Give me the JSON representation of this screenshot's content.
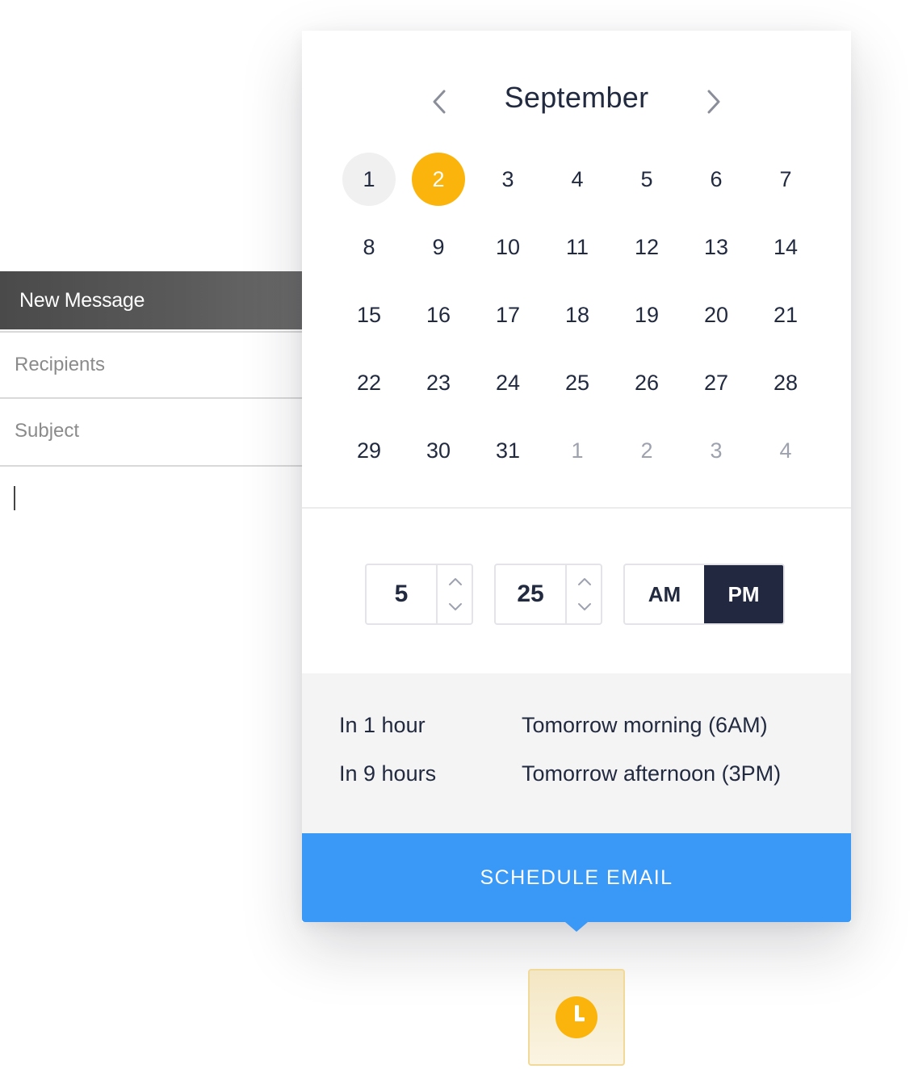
{
  "compose": {
    "title": "New Message",
    "recipients_placeholder": "Recipients",
    "subject_placeholder": "Subject"
  },
  "calendar": {
    "month": "September",
    "weeks": [
      [
        {
          "d": "1",
          "state": "today"
        },
        {
          "d": "2",
          "state": "selected"
        },
        {
          "d": "3"
        },
        {
          "d": "4"
        },
        {
          "d": "5"
        },
        {
          "d": "6"
        },
        {
          "d": "7"
        }
      ],
      [
        {
          "d": "8"
        },
        {
          "d": "9"
        },
        {
          "d": "10"
        },
        {
          "d": "11"
        },
        {
          "d": "12"
        },
        {
          "d": "13"
        },
        {
          "d": "14"
        }
      ],
      [
        {
          "d": "15"
        },
        {
          "d": "16"
        },
        {
          "d": "17"
        },
        {
          "d": "18"
        },
        {
          "d": "19"
        },
        {
          "d": "20"
        },
        {
          "d": "21"
        }
      ],
      [
        {
          "d": "22"
        },
        {
          "d": "23"
        },
        {
          "d": "24"
        },
        {
          "d": "25"
        },
        {
          "d": "26"
        },
        {
          "d": "27"
        },
        {
          "d": "28"
        }
      ],
      [
        {
          "d": "29"
        },
        {
          "d": "30"
        },
        {
          "d": "31"
        },
        {
          "d": "1",
          "state": "muted"
        },
        {
          "d": "2",
          "state": "muted"
        },
        {
          "d": "3",
          "state": "muted"
        },
        {
          "d": "4",
          "state": "muted"
        }
      ]
    ]
  },
  "time": {
    "hour": "5",
    "minute": "25",
    "am_label": "AM",
    "pm_label": "PM",
    "selected_period": "PM"
  },
  "quick_options": {
    "in_1_hour": "In 1 hour",
    "in_9_hours": "In 9 hours",
    "tomorrow_morning": "Tomorrow morning (6AM)",
    "tomorrow_afternoon": "Tomorrow afternoon (3PM)"
  },
  "schedule_button": "SCHEDULE EMAIL",
  "icons": {
    "prev_month": "chevron-left-icon",
    "next_month": "chevron-right-icon",
    "spin_up": "chevron-up-icon",
    "spin_down": "chevron-down-icon",
    "trigger": "clock-icon"
  },
  "colors": {
    "accent_yellow": "#fbb40c",
    "button_blue": "#3a98f7",
    "dark_navy": "#222840",
    "compose_header": "#4a4a4a"
  }
}
